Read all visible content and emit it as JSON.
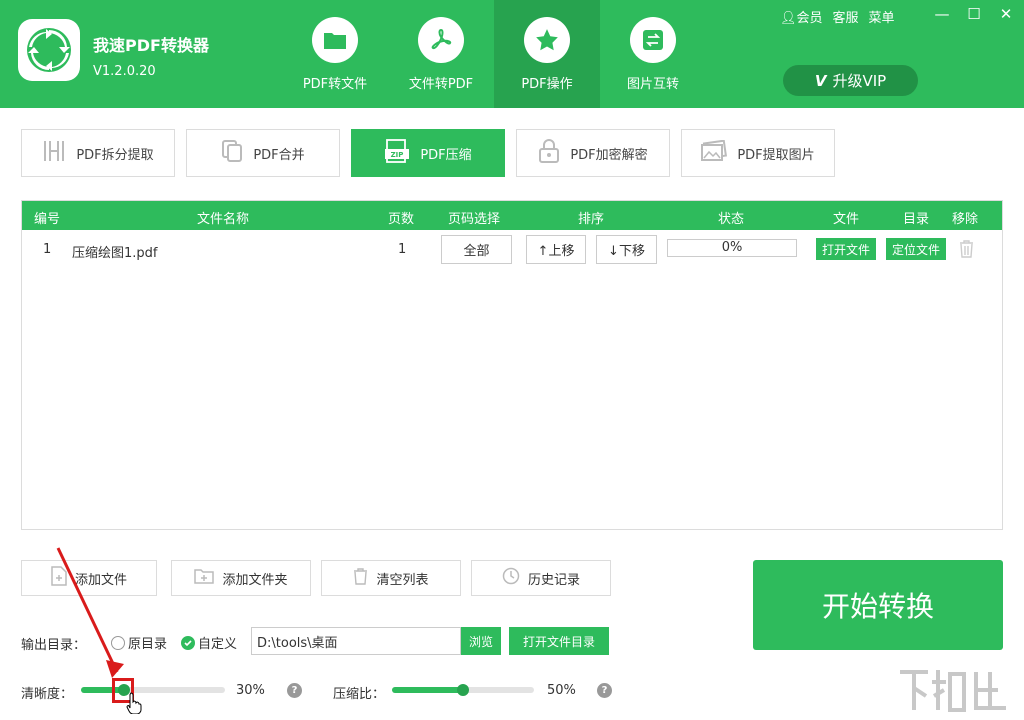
{
  "app": {
    "name": "我速PDF转换器",
    "version": "V1.2.0.20"
  },
  "nav": [
    {
      "label": "PDF转文件",
      "icon": "folder-icon",
      "active": false
    },
    {
      "label": "文件转PDF",
      "icon": "pdf-acrobat-icon",
      "active": false
    },
    {
      "label": "PDF操作",
      "icon": "star-icon",
      "active": true
    },
    {
      "label": "图片互转",
      "icon": "swap-icon",
      "active": false
    }
  ],
  "top_links": {
    "member": "会员",
    "service": "客服",
    "menu": "菜单"
  },
  "vip_label": "升级VIP",
  "tabs": [
    {
      "label": "PDF拆分提取",
      "icon": "split-icon",
      "active": false
    },
    {
      "label": "PDF合并",
      "icon": "merge-icon",
      "active": false
    },
    {
      "label": "PDF压缩",
      "icon": "zip-icon",
      "active": true
    },
    {
      "label": "PDF加密解密",
      "icon": "lock-icon",
      "active": false
    },
    {
      "label": "PDF提取图片",
      "icon": "image-icon",
      "active": false
    }
  ],
  "table": {
    "headers": {
      "num": "编号",
      "name": "文件名称",
      "pages": "页数",
      "page_select": "页码选择",
      "sort": "排序",
      "status": "状态",
      "file": "文件",
      "dir": "目录",
      "remove": "移除"
    },
    "rows": [
      {
        "num": "1",
        "name": "压缩绘图1.pdf",
        "pages": "1",
        "page_select": "全部",
        "up": "↑上移",
        "down": "↓下移",
        "progress": "0%",
        "open_file": "打开文件",
        "locate_file": "定位文件"
      }
    ]
  },
  "actions": {
    "add_file": "添加文件",
    "add_folder": "添加文件夹",
    "clear_list": "清空列表",
    "history": "历史记录"
  },
  "start_label": "开始转换",
  "output": {
    "label": "输出目录：",
    "original": "原目录",
    "custom": "自定义",
    "path": "D:\\tools\\桌面",
    "browse": "浏览",
    "open_dir": "打开文件目录"
  },
  "clarity": {
    "label": "清晰度：",
    "value": 30,
    "value_label": "30%"
  },
  "compress": {
    "label": "压缩比：",
    "value": 50,
    "value_label": "50%"
  },
  "colors": {
    "primary": "#2ebb5c",
    "primary_dark": "#27a34f",
    "annotation": "#d91b1b"
  }
}
